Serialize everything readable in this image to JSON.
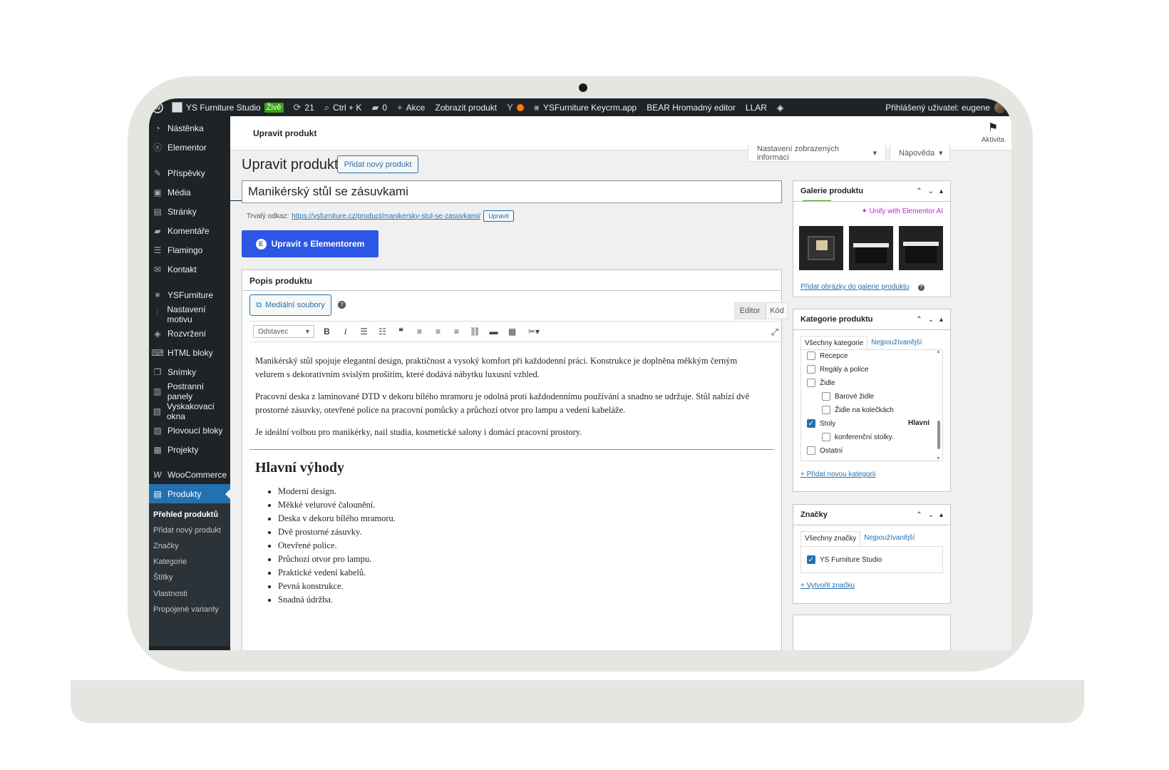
{
  "adminbar": {
    "site_name": "YS Furniture Studio",
    "live_label": "Živě",
    "updates_count": "21",
    "search_shortcut": "Ctrl + K",
    "comments_count": "0",
    "new_label": "Akce",
    "view_product": "Zobrazit produkt",
    "keycrm": "YSFurniture Keycrm.app",
    "bear": "BEAR Hromadný editor",
    "llar": "LLAR",
    "user": "Přihlášený uživatel: eugene"
  },
  "sidebar": {
    "items": [
      {
        "label": "Nástěnka",
        "icon": "dashboard-icon"
      },
      {
        "label": "Elementor",
        "icon": "elementor-icon"
      },
      {
        "label": "Příspěvky",
        "icon": "pin-icon"
      },
      {
        "label": "Média",
        "icon": "media-icon"
      },
      {
        "label": "Stránky",
        "icon": "pages-icon"
      },
      {
        "label": "Komentáře",
        "icon": "comments-icon"
      },
      {
        "label": "Flamingo",
        "icon": "flamingo-icon"
      },
      {
        "label": "Kontakt",
        "icon": "mail-icon"
      },
      {
        "label": "YSFurniture",
        "icon": "ys-icon"
      },
      {
        "label": "Nastavení motivu",
        "icon": "sliders-icon"
      },
      {
        "label": "Rozvržení",
        "icon": "layers-icon"
      },
      {
        "label": "HTML bloky",
        "icon": "html-icon"
      },
      {
        "label": "Snímky",
        "icon": "slides-icon"
      },
      {
        "label": "Postranní panely",
        "icon": "sidebar-panels-icon"
      },
      {
        "label": "Vyskakovací okna",
        "icon": "popup-icon"
      },
      {
        "label": "Plovoucí bloky",
        "icon": "floating-icon"
      },
      {
        "label": "Projekty",
        "icon": "briefcase-icon"
      },
      {
        "label": "WooCommerce",
        "icon": "woo-icon"
      },
      {
        "label": "Produkty",
        "icon": "archive-icon"
      }
    ],
    "submenu": [
      "Přehled produktů",
      "Přidat nový produkt",
      "Značky",
      "Kategorie",
      "Štítky",
      "Vlastnosti",
      "Propojené varianty"
    ]
  },
  "topstrip": {
    "title": "Upravit produkt",
    "activity": "Aktivita"
  },
  "screen_options": "Nastavení zobrazených informací",
  "help": "Nápověda",
  "page": {
    "title": "Upravit produkt",
    "add_new": "Přidat nový produkt",
    "product_title": "Manikérský stůl se zásuvkami",
    "permalink_label": "Trvalý odkaz:",
    "permalink_url": "https://ysfurniture.cz/product/manikersky-stul-se-zasuvkami/",
    "permalink_edit": "Upravit",
    "elementor_btn": "Upravit s Elementorem"
  },
  "description": {
    "heading": "Popis produktu",
    "media_btn": "Mediální soubory",
    "tab_editor": "Editor",
    "tab_code": "Kód",
    "format": "Odstavec",
    "p1": "Manikérský stůl spojuje elegantní design, praktičnost a vysoký komfort při každodenní práci. Konstrukce je doplněna měkkým černým velurem s dekorativním svislým prošitím, které dodává nábytku luxusní vzhled.",
    "p2": "Pracovní deska z laminované DTD v dekoru bílého mramoru je odolná proti každodennímu používání a snadno se udržuje. Stůl nabízí dvě prostorné zásuvky, otevřené police na pracovní pomůcky a průchozí otvor pro lampu a vedení kabeláže.",
    "p3": "Je ideální volbou pro manikérky, nail studia, kosmetické salony i domácí pracovní prostory.",
    "h2": "Hlavní výhody",
    "bullets": [
      "Moderní design.",
      "Měkké velurové čalounění.",
      "Deska v dekoru bílého mramoru.",
      "Dvě prostorné zásuvky.",
      "Otevřené police.",
      "Průchozí otvor pro lampu.",
      "Praktické vedení kabelů.",
      "Pevná konstrukce.",
      "Snadná údržba."
    ]
  },
  "gallery": {
    "heading": "Galerie produktu",
    "ai_link": "Unify with Elementor AI",
    "add_link": "Přidat obrázky do galerie produktu"
  },
  "categories": {
    "heading": "Kategorie produktu",
    "tab_all": "Všechny kategorie",
    "tab_popular": "Nejpoužívanější",
    "items": [
      {
        "label": "Recepce",
        "checked": false,
        "indent": false
      },
      {
        "label": "Regály a police",
        "checked": false,
        "indent": false
      },
      {
        "label": "Židle",
        "checked": false,
        "indent": false
      },
      {
        "label": "Barové židle",
        "checked": false,
        "indent": true
      },
      {
        "label": "Židle na kolečkách",
        "checked": false,
        "indent": true
      },
      {
        "label": "Stoly",
        "checked": true,
        "indent": false
      },
      {
        "label": "konferenční stolky.",
        "checked": false,
        "indent": true
      },
      {
        "label": "Ostatní",
        "checked": false,
        "indent": false
      }
    ],
    "primary_label": "Hlavní",
    "add_link": "+ Přidat novou kategorii"
  },
  "brands": {
    "heading": "Značky",
    "tab_all": "Všechny značky",
    "tab_popular": "Nejpoužívanější",
    "brand": "YS Furniture Studio",
    "add_link": "+ Vytvořit značku"
  },
  "colors": {
    "accent": "#2271b1",
    "elementor": "#2c56e6",
    "adminbar": "#1d2327",
    "laptop": "#e5e6e1"
  }
}
